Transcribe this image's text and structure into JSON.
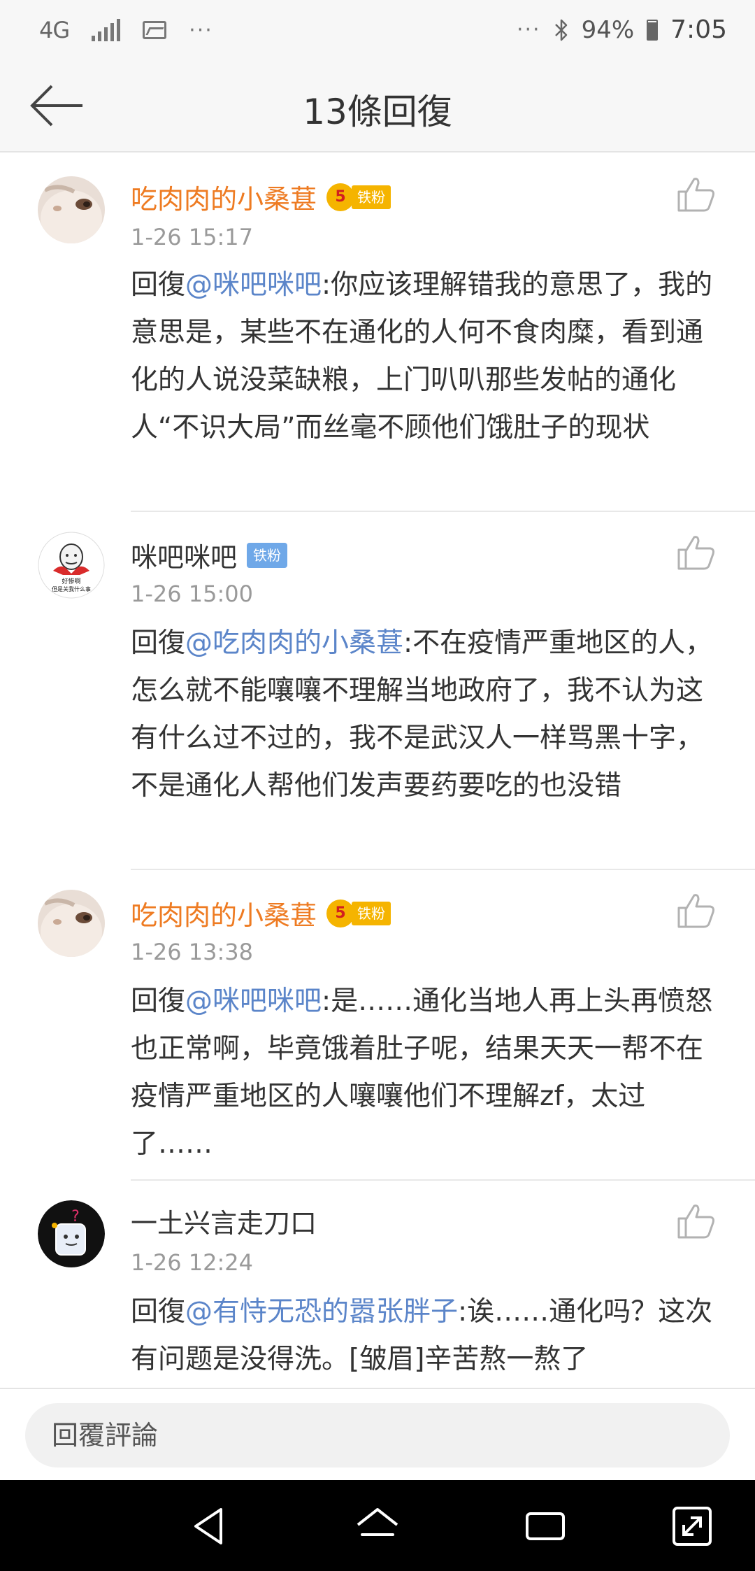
{
  "status_bar": {
    "network": "4G",
    "more": "···",
    "more_right": "···",
    "battery_percent": "94%",
    "time": "7:05"
  },
  "header": {
    "title": "13條回復"
  },
  "comments": [
    {
      "author": "吃肉肉的小桑葚",
      "author_color": "#ee7b22",
      "level": "5",
      "badge": "铁粉",
      "badge_color": "#f5b400",
      "time": "1-26 15:17",
      "reply_prefix": "回復",
      "mention": "@咪吧咪吧",
      "text": ":你应该理解错我的意思了，我的意思是，某些不在通化的人何不食肉糜，看到通化的人说没菜缺粮，上门叭叭那些发帖的通化人“不识大局”而丝毫不顾他们饿肚子的现状"
    },
    {
      "author": "咪吧咪吧",
      "author_color": "#333333",
      "badge": "铁粉",
      "badge_color": "#6fa8e8",
      "avatar_text_1": "好惨啊",
      "avatar_text_2": "但是关我什么事",
      "time": "1-26 15:00",
      "reply_prefix": "回復",
      "mention": "@吃肉肉的小桑葚",
      "text": ":不在疫情严重地区的人，怎么就不能嚷嚷不理解当地政府了，我不认为这有什么过不过的，我不是武汉人一样骂黑十字，不是通化人帮他们发声要药要吃的也没错"
    },
    {
      "author": "吃肉肉的小桑葚",
      "author_color": "#ee7b22",
      "level": "5",
      "badge": "铁粉",
      "badge_color": "#f5b400",
      "time": "1-26 13:38",
      "reply_prefix": "回復",
      "mention": "@咪吧咪吧",
      "text": ":是……通化当地人再上头再愤怒也正常啊，毕竟饿着肚子呢，结果天天一帮不在疫情严重地区的人嚷嚷他们不理解zf，太过了……"
    },
    {
      "author": "一土兴言走刀口",
      "author_color": "#333333",
      "time": "1-26 12:24",
      "reply_prefix": "回復",
      "mention": "@有恃无恐的嚣张胖子",
      "text": ":诶……通化吗？这次有问题是没得洗。[皱眉]辛苦熬一熬了"
    }
  ],
  "reply_bar": {
    "placeholder": "回覆評論"
  },
  "nav": {
    "back": "back",
    "home": "home",
    "recents": "recents",
    "rotate": "rotate"
  }
}
